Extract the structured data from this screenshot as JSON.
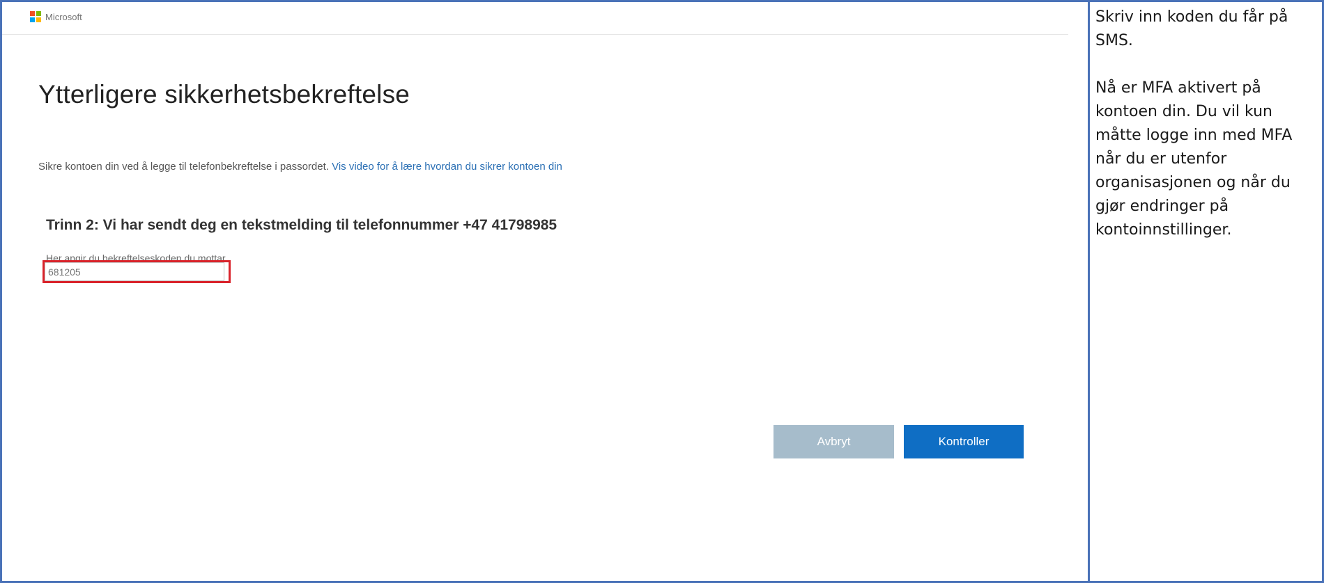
{
  "header": {
    "brand": "Microsoft",
    "logo_colors": [
      "#f25022",
      "#7fba00",
      "#00a4ef",
      "#ffb900"
    ]
  },
  "page": {
    "title": "Ytterligere sikkerhetsbekreftelse",
    "description": "Sikre kontoen din ved å legge til telefonbekreftelse i passordet.",
    "video_link": "Vis video for å lære hvordan du sikrer kontoen din",
    "step_heading": "Trinn 2: Vi har sendt deg en tekstmelding til telefonnummer +47 41798985",
    "input_label": "Her angir du bekreftelseskoden du mottar",
    "code_value": "681205"
  },
  "buttons": {
    "cancel_label": "Avbryt",
    "verify_label": "Kontroller"
  },
  "side_panel": {
    "paragraph_1": "Skriv inn koden du får på SMS.",
    "paragraph_2": "Nå er MFA aktivert på kontoen din. Du vil kun måtte logge inn med MFA når du er utenfor organisasjonen og når du gjør endringer på kontoinnstillinger."
  },
  "colors": {
    "frame_border": "#4a72b8",
    "highlight_border": "#d9232b",
    "link": "#2a6fb4",
    "primary_button": "#0f6ec4",
    "secondary_button": "#a6bccb"
  }
}
